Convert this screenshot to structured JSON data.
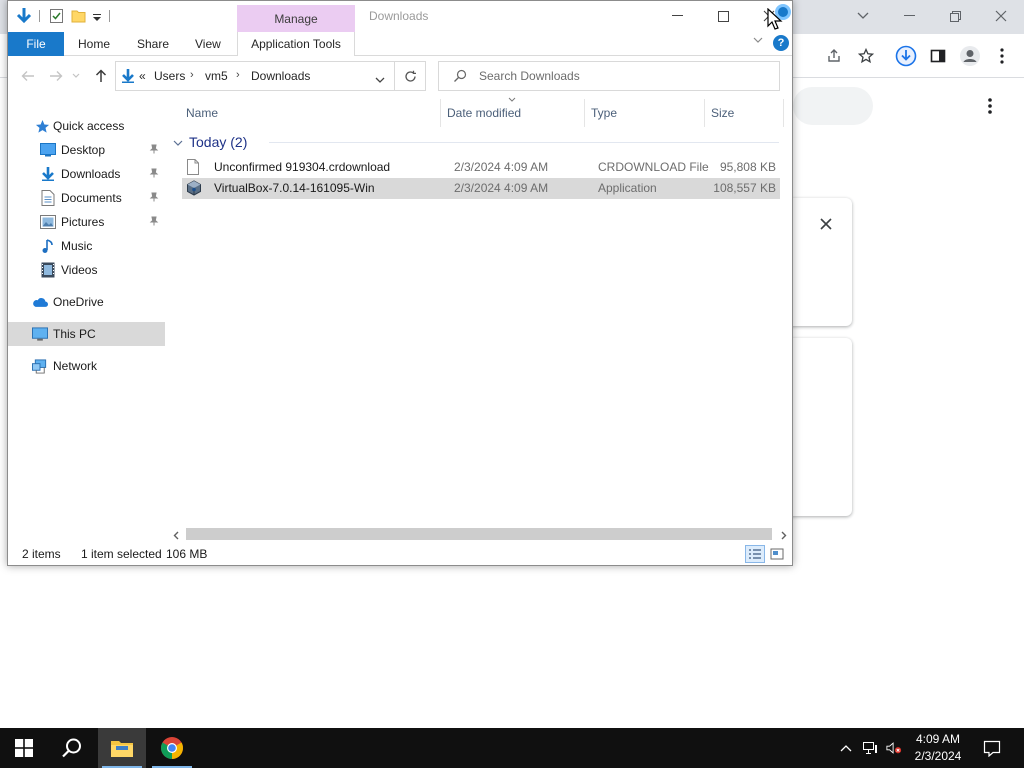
{
  "explorer": {
    "window_title": "Downloads",
    "context_tab": "Manage",
    "ribbon_tabs": [
      "File",
      "Home",
      "Share",
      "View",
      "Application Tools"
    ],
    "address": {
      "overflow": "«",
      "segments": [
        "Users",
        "vm5",
        "Downloads"
      ]
    },
    "search_placeholder": "Search Downloads",
    "nav_pane": {
      "quick_access": "Quick access",
      "pinned": [
        "Desktop",
        "Downloads",
        "Documents",
        "Pictures"
      ],
      "unpinned": [
        "Music",
        "Videos"
      ],
      "onedrive": "OneDrive",
      "this_pc": "This PC",
      "network": "Network"
    },
    "columns": [
      "Name",
      "Date modified",
      "Type",
      "Size"
    ],
    "group_label": "Today (2)",
    "files": [
      {
        "name": "Unconfirmed 919304.crdownload",
        "date": "2/3/2024 4:09 AM",
        "type": "CRDOWNLOAD File",
        "size": "95,808 KB",
        "selected": false
      },
      {
        "name": "VirtualBox-7.0.14-161095-Win",
        "date": "2/3/2024 4:09 AM",
        "type": "Application",
        "size": "108,557 KB",
        "selected": true
      }
    ],
    "status": {
      "item_count": "2 items",
      "selection": "1 item selected",
      "selection_size": "106 MB"
    }
  },
  "taskbar": {
    "time": "4:09 AM",
    "date": "2/3/2024",
    "pinned_apps": [
      "start-button",
      "search",
      "file-explorer",
      "chrome"
    ]
  },
  "colors": {
    "accent_blue": "#1979ca",
    "manage_tab": "#ebccf2",
    "selection_gray": "#d9d9d9",
    "taskbar_bg": "#101010",
    "group_header": "#1e3287"
  }
}
